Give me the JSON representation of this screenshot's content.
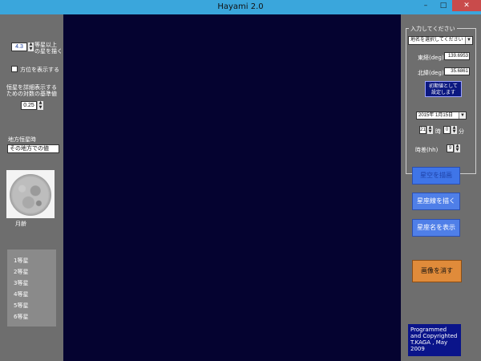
{
  "window": {
    "title": "Hayami 2.0",
    "controls": {
      "minimize": "–",
      "maximize": "□",
      "close": "✕"
    }
  },
  "left_panel": {
    "magnitude_value": "4.3",
    "magnitude_label_line1": "等星以上",
    "magnitude_label_line2": "の星を描く",
    "show_direction_label": "方位を表示する",
    "threshold_label_line1": "恒星を詳細表示する",
    "threshold_label_line2": "ための対数の基準値",
    "threshold_value": "0.25",
    "local_sidereal_time_label": "地方恒星時",
    "local_sidereal_time_value": "その地方での値",
    "moon_age_label": "月齢",
    "legend": [
      "1等星",
      "2等星",
      "3等星",
      "4等星",
      "5等星",
      "6等星"
    ]
  },
  "right_panel": {
    "group_title": "入力してください",
    "location_placeholder": "地名を選択してください",
    "longitude_label": "東経(deg)",
    "longitude_value": "139.6953",
    "latitude_label": "北緯(deg)",
    "latitude_value": "35.6861",
    "set_initial_line1": "初期値として",
    "set_initial_line2": "設定します",
    "date_value": "2015年  1月15日",
    "hour_value": "21",
    "hour_unit": "時",
    "minute_value": "0",
    "minute_unit": "分",
    "timezone_label": "時差(hh)",
    "timezone_value": "9",
    "buttons": {
      "draw_sky": "星空を描画",
      "draw_constellation_lines": "星座線を描く",
      "show_constellation_names": "星座名を表示",
      "clear_image": "画像を消す"
    },
    "credit": "Programmed and Copyrighted T.KAGA , May 2009"
  }
}
